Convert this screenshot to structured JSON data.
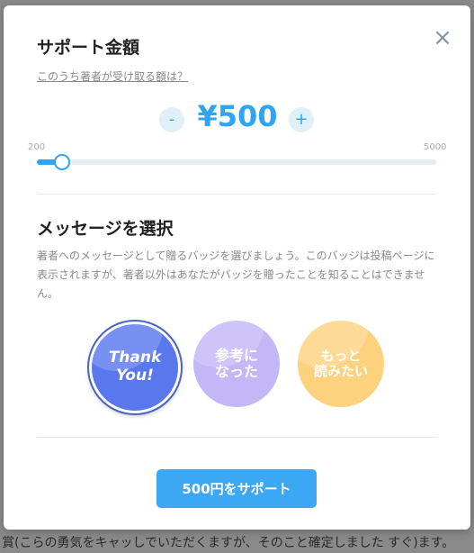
{
  "background": {
    "text": "賞(こらの勇気をキャッしでいただくますが、そのこと確定しました すぐ)ます。"
  },
  "modal": {
    "close_icon": "×",
    "title": "サポート金額",
    "royalty_link": "このうち著者が受け取る額は？",
    "amount": {
      "minus": "-",
      "plus": "+",
      "value": "¥500",
      "min_label": "200",
      "max_label": "5000",
      "slider_min": 200,
      "slider_max": 5000,
      "slider_value": 500
    },
    "message_title": "メッセージを選択",
    "message_description": "著者へのメッセージとして贈るバッジを選びましょう。このバッジは投稿ページに表示されますが、著者以外はあなたがバッジを贈ったことを知ることはできません。",
    "badges": [
      {
        "line1": "Thank",
        "line2": "You!",
        "selected": true,
        "color": "#5a78ee"
      },
      {
        "line1": "参考に",
        "line2": "なった",
        "selected": false,
        "color": "#c4b7f8"
      },
      {
        "line1": "もっと",
        "line2": "読みたい",
        "selected": false,
        "color": "#fdd27e"
      }
    ],
    "support_button": "500円をサポート"
  },
  "colors": {
    "accent": "#2fa4f0",
    "button": "#3ca8f4"
  }
}
